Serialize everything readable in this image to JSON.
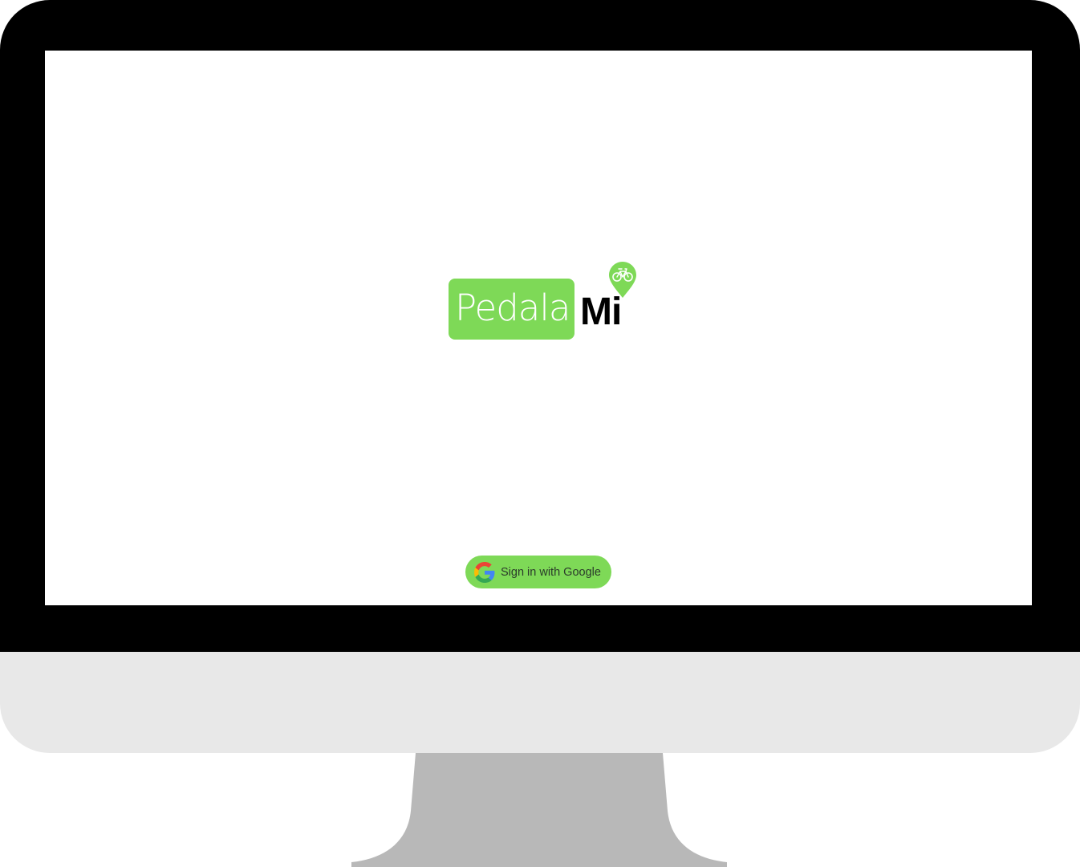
{
  "brand": {
    "word": "Pedala",
    "suffix": "Mi",
    "accent_color": "#7ed957",
    "pin_icon": "bike-location-pin-icon"
  },
  "login": {
    "google_button_label": "Sign in with Google",
    "google_icon": "google-g-icon"
  },
  "device": {
    "frame": "desktop-monitor"
  }
}
